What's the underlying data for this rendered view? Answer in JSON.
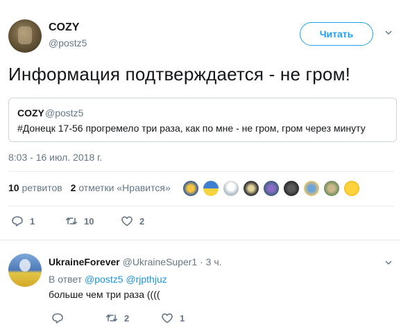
{
  "tweet": {
    "author_name": "COZY",
    "author_handle": "@postz5",
    "follow_label": "Читать",
    "text": "Информация подтверждается - не гром!",
    "quote": {
      "name": "COZY",
      "handle": "@postz5",
      "text": "#Донецк 17-56 прогремело три раза, как по мне - не гром, гром через минуту"
    },
    "timestamp": "8:03 - 16 июл. 2018 г.",
    "stats": {
      "retweets_count": "10",
      "retweets_label": "ретвитов",
      "likes_count": "2",
      "likes_label": "отметки «Нравится»"
    },
    "actions": {
      "replies": "1",
      "retweets": "10",
      "likes": "2"
    }
  },
  "reply": {
    "name": "UkraineForever",
    "handle": "@UkraineSuper1",
    "time": "· 3 ч.",
    "reply_prefix": "В ответ",
    "reply_users": [
      "@postz5",
      "@rjpthjuz"
    ],
    "text": "больше чем три раза ((((",
    "actions": {
      "replies": "",
      "retweets": "2",
      "likes": "1"
    }
  },
  "colors": {
    "accent": "#1da1f2",
    "link": "#1b95e0",
    "muted": "#657786",
    "like_red": "#e0245e"
  },
  "icons": [
    "reply-icon",
    "retweet-icon",
    "like-icon",
    "chevron-down-icon"
  ]
}
